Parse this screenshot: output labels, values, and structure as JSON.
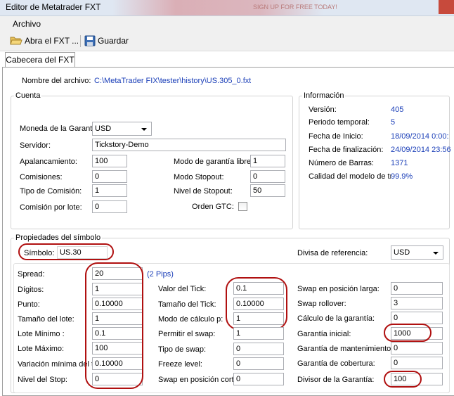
{
  "window": {
    "title": "Editor de Metatrader FXT",
    "background_text": "SIGN UP FOR FREE TODAY!"
  },
  "menu": {
    "archivo": "Archivo"
  },
  "toolbar": {
    "open_label": "Abra el FXT ...",
    "save_label": "Guardar"
  },
  "tabs": {
    "cabecera": "Cabecera del FXT"
  },
  "file": {
    "label": "Nombre del archivo:",
    "path": "C:\\MetaTrader FIX\\tester\\history\\US.305_0.fxt"
  },
  "cuenta": {
    "legend": "Cuenta",
    "moneda_label": "Moneda de la Garantí",
    "moneda_value": "USD",
    "servidor_label": "Servidor:",
    "servidor_value": "Tickstory-Demo",
    "apalancamiento_label": "Apalancamiento:",
    "apalancamiento_value": "100",
    "comisiones_label": "Comisiones:",
    "comisiones_value": "0",
    "tipo_comision_label": "Tipo de Comisión:",
    "tipo_comision_value": "1",
    "comision_lote_label": "Comisión por lote:",
    "comision_lote_value": "0",
    "modo_garantia_libre_label": "Modo de garantía libre:",
    "modo_garantia_libre_value": "1",
    "modo_stopout_label": "Modo Stopout:",
    "modo_stopout_value": "0",
    "nivel_stopout_label": "Nivel de Stopout:",
    "nivel_stopout_value": "50",
    "orden_gtc_label": "Orden GTC:"
  },
  "info": {
    "legend": "Información",
    "version_label": "Versión:",
    "version_value": "405",
    "periodo_label": "Periodo temporal:",
    "periodo_value": "5",
    "inicio_label": "Fecha de Inicio:",
    "inicio_value": "18/09/2014 0:00:",
    "fin_label": "Fecha de finalización:",
    "fin_value": "24/09/2014 23:56",
    "barras_label": "Número de Barras:",
    "barras_value": "1371",
    "calidad_label": "Calidad del modelo de tr",
    "calidad_value": "99.9%"
  },
  "simbolo": {
    "legend": "Propiedades del símbolo",
    "simbolo_label": "Símbolo:",
    "simbolo_value": "US.30",
    "divisa_label": "Divisa de referencia:",
    "divisa_value": "USD",
    "spread_label": "Spread:",
    "spread_value": "20",
    "spread_pips": "(2 Pips)",
    "digitos_label": "Dígitos:",
    "digitos_value": "1",
    "punto_label": "Punto:",
    "punto_value": "0.10000",
    "tamano_lote_label": "Tamaño del lote:",
    "tamano_lote_value": "1",
    "lote_minimo_label": "Lote Mínimo :",
    "lote_minimo_value": "0.1",
    "lote_maximo_label": "Lote Máximo:",
    "lote_maximo_value": "100",
    "variacion_label": "Variación mínima del ta",
    "variacion_value": "0.10000",
    "nivel_stop_label": "Nivel del Stop:",
    "nivel_stop_value": "0",
    "valor_tick_label": "Valor del Tick:",
    "valor_tick_value": "0.1",
    "tamano_tick_label": "Tamaño del Tick:",
    "tamano_tick_value": "0.10000",
    "modo_calculo_label": "Modo de cálculo p:",
    "modo_calculo_value": "1",
    "permitir_swap_label": "Permitir el swap:",
    "permitir_swap_value": "1",
    "tipo_swap_label": "Tipo de swap:",
    "tipo_swap_value": "0",
    "freeze_label": "Freeze level:",
    "freeze_value": "0",
    "swap_corta_label": "Swap en posición corta",
    "swap_corta_value": "0",
    "swap_larga_label": "Swap en posición larga:",
    "swap_larga_value": "0",
    "swap_rollover_label": "Swap rollover:",
    "swap_rollover_value": "3",
    "calculo_garantia_label": "Cálculo de la garantía:",
    "calculo_garantia_value": "0",
    "garantia_inicial_label": "Garantía inicial:",
    "garantia_inicial_value": "1000",
    "garantia_mantenimiento_label": "Garantía de mantenimiento:",
    "garantia_mantenimiento_value": "0",
    "garantia_cobertura_label": "Garantía de cobertura:",
    "garantia_cobertura_value": "0",
    "divisor_label": "Divisor de la Garantía:",
    "divisor_value": "100"
  }
}
